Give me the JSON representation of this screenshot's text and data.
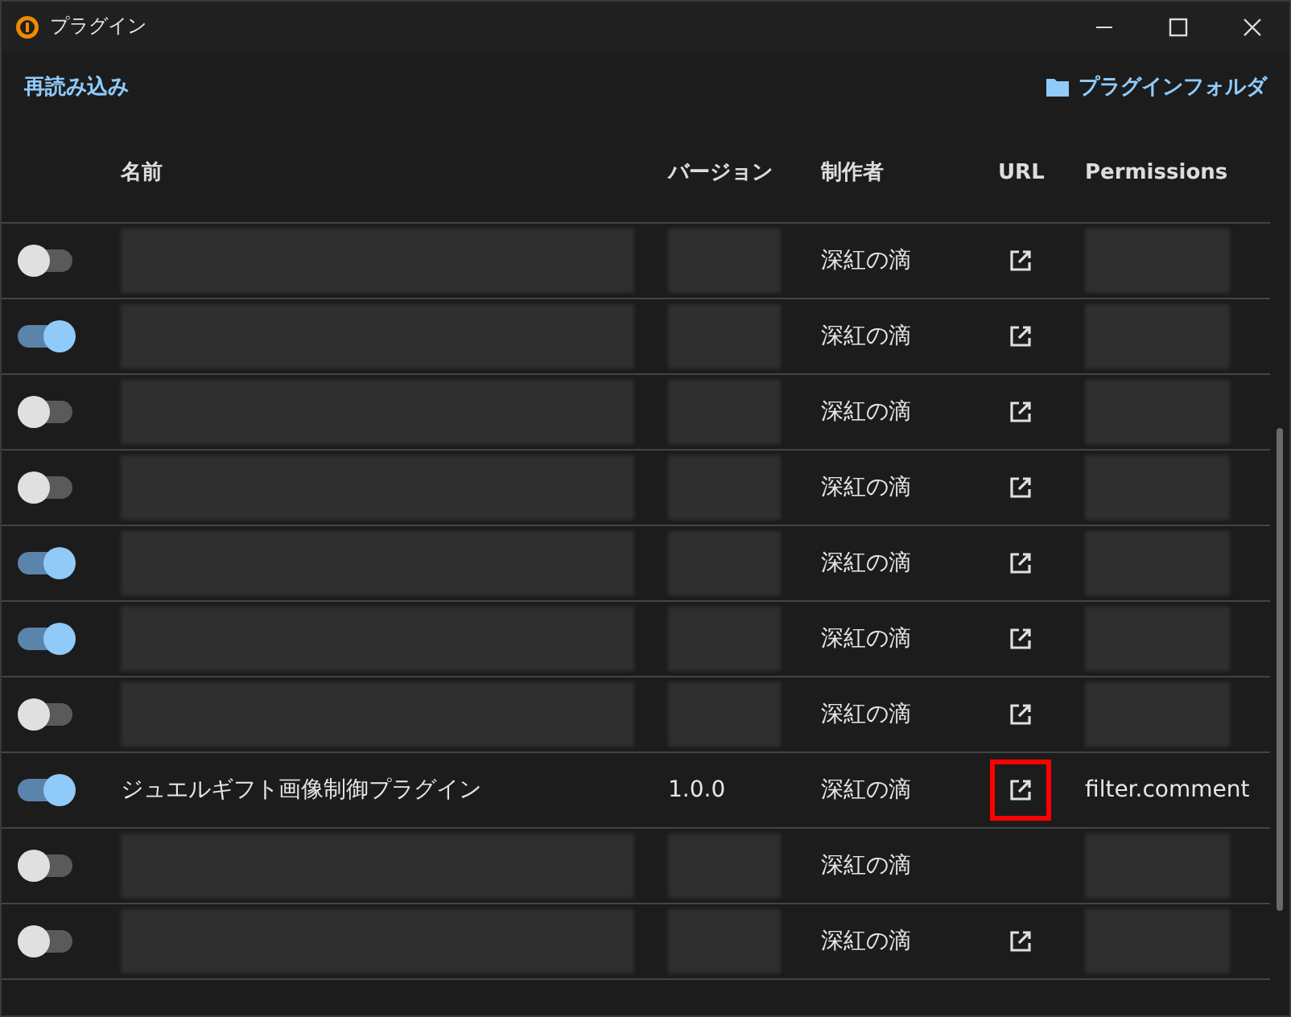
{
  "window": {
    "title": "プラグイン"
  },
  "toolbar": {
    "reload": "再読み込み",
    "folder": "プラグインフォルダ"
  },
  "table": {
    "columns": [
      "名前",
      "バージョン",
      "制作者",
      "URL",
      "Permissions"
    ],
    "rows": [
      {
        "enabled": false,
        "author": "深紅の滴",
        "has_url": true,
        "redacted": true
      },
      {
        "enabled": true,
        "author": "深紅の滴",
        "has_url": true,
        "redacted": true
      },
      {
        "enabled": false,
        "author": "深紅の滴",
        "has_url": true,
        "redacted": true
      },
      {
        "enabled": false,
        "author": "深紅の滴",
        "has_url": true,
        "redacted": true
      },
      {
        "enabled": true,
        "author": "深紅の滴",
        "has_url": true,
        "redacted": true
      },
      {
        "enabled": true,
        "author": "深紅の滴",
        "has_url": true,
        "redacted": true
      },
      {
        "enabled": false,
        "author": "深紅の滴",
        "has_url": true,
        "redacted": true
      },
      {
        "enabled": true,
        "name": "ジュエルギフト画像制御プラグイン",
        "version": "1.0.0",
        "author": "深紅の滴",
        "has_url": true,
        "url_highlighted": true,
        "permissions": "filter.comment",
        "redacted": false
      },
      {
        "enabled": false,
        "author": "深紅の滴",
        "has_url": false,
        "redacted": true
      },
      {
        "enabled": false,
        "author": "深紅の滴",
        "has_url": true,
        "redacted": true
      }
    ]
  }
}
